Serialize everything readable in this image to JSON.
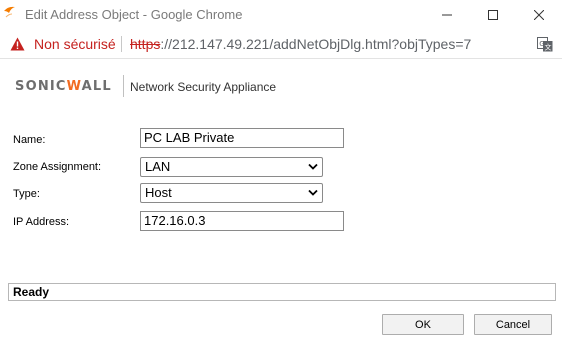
{
  "window": {
    "title": "Edit Address Object - Google Chrome"
  },
  "addressbar": {
    "security_label": "Non sécurisé",
    "url_scheme": "https",
    "url_rest": "://212.147.49.221/addNetObjDlg.html?objTypes=7"
  },
  "brand": {
    "logo_text_1": "SONIC",
    "logo_text_accent": "W",
    "logo_text_2": "ALL",
    "product": "Network Security Appliance"
  },
  "form": {
    "name_label": "Name:",
    "name_value": "PC LAB Private",
    "zone_label": "Zone Assignment:",
    "zone_value": "LAN",
    "type_label": "Type:",
    "type_value": "Host",
    "ip_label": "IP Address:",
    "ip_value": "172.16.0.3"
  },
  "status": {
    "text": "Ready"
  },
  "buttons": {
    "ok": "OK",
    "cancel": "Cancel"
  },
  "colors": {
    "security_red": "#c5221f",
    "brand_orange": "#f26b21",
    "brand_gray": "#6e6e6e"
  },
  "icons": {
    "app": "chrome-logo-icon",
    "security": "warning-triangle-icon",
    "translate": "translate-icon",
    "minimize": "minimize-icon",
    "maximize": "maximize-icon",
    "close": "close-icon",
    "dropdown": "chevron-down-icon"
  }
}
